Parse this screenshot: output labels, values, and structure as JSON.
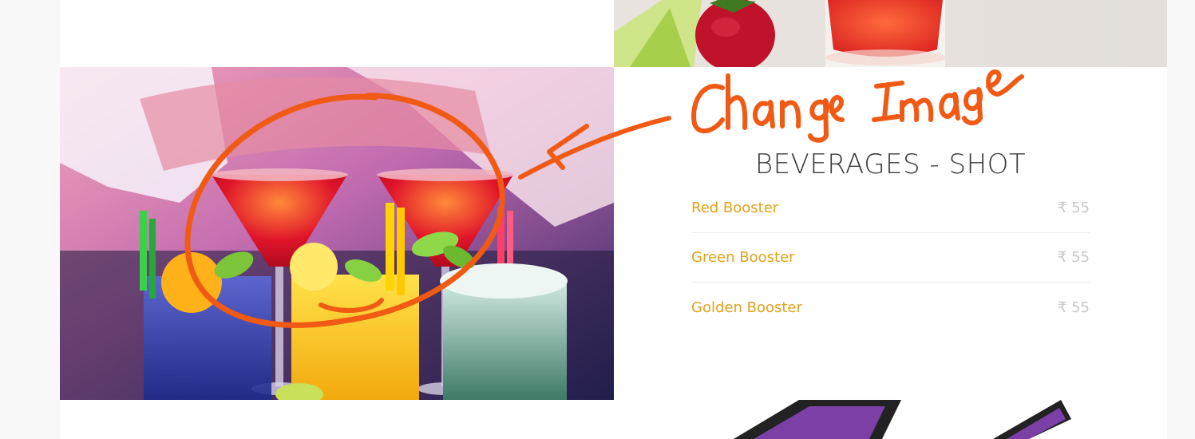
{
  "menu": {
    "title": "BEVERAGES - SHOT",
    "items": [
      {
        "name": "Red Booster",
        "price": "₹ 55"
      },
      {
        "name": "Green Booster",
        "price": "₹ 55"
      },
      {
        "name": "Golden Booster",
        "price": "₹ 55"
      }
    ]
  },
  "annotation": {
    "text": "Change Image",
    "color": "#f05a14"
  },
  "colors": {
    "item_name": "#e3a21b",
    "item_price": "#c7c7c7",
    "title": "#3a3a3a",
    "page_bg": "#f8f8f8",
    "card_bg": "#ffffff"
  }
}
